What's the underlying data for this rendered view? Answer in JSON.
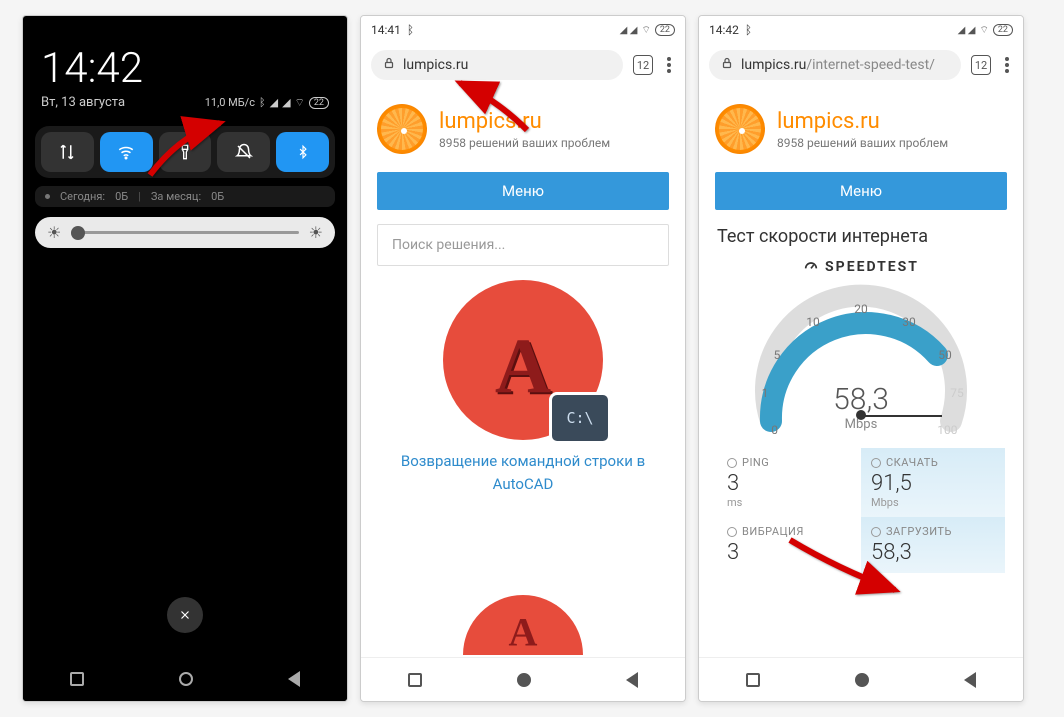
{
  "phone1": {
    "time": "14:42",
    "date": "Вт, 13 августа",
    "net_speed": "11,0 МБ/с",
    "battery": "22",
    "usage_today_label": "Сегодня:",
    "usage_today_val": "0Б",
    "usage_month_label": "За месяц:",
    "usage_month_val": "0Б"
  },
  "phone2": {
    "status_time": "14:41",
    "battery": "22",
    "url": "lumpics.ru",
    "tab_count": "12",
    "site_name": "lumpics.ru",
    "site_tag": "8958 решений ваших проблем",
    "menu": "Меню",
    "search_placeholder": "Поиск решения...",
    "article_title": "Возвращение командной строки в AutoCAD",
    "cmd_prompt": "C:\\"
  },
  "phone3": {
    "status_time": "14:42",
    "battery": "22",
    "url_main": "lumpics.ru",
    "url_path": "/internet-speed-test/",
    "tab_count": "12",
    "site_name": "lumpics.ru",
    "site_tag": "8958 решений ваших проблем",
    "menu": "Меню",
    "page_title": "Тест скорости интернета",
    "speedtest_brand": "SPEEDTEST",
    "gauge": {
      "value": "58,3",
      "unit": "Mbps",
      "ticks": {
        "t0": "0",
        "t1": "1",
        "t5": "5",
        "t10": "10",
        "t20": "20",
        "t30": "30",
        "t50": "50",
        "t75": "75",
        "t100": "100"
      }
    },
    "stats": {
      "ping_label": "PING",
      "ping_val": "3",
      "ping_unit": "ms",
      "download_label": "СКАЧАТЬ",
      "download_val": "91,5",
      "download_unit": "Mbps",
      "jitter_label": "ВИБРАЦИЯ",
      "jitter_val": "3",
      "upload_label": "ЗАГРУЗИТЬ",
      "upload_val": "58,3"
    }
  },
  "chart_data": {
    "type": "gauge",
    "title": "SPEEDTEST",
    "unit": "Mbps",
    "value": 58.3,
    "ticks": [
      0,
      1,
      5,
      10,
      20,
      30,
      50,
      75,
      100
    ],
    "range": [
      0,
      100
    ],
    "metrics": [
      {
        "name": "PING",
        "value": 3,
        "unit": "ms"
      },
      {
        "name": "СКАЧАТЬ",
        "value": 91.5,
        "unit": "Mbps"
      },
      {
        "name": "ВИБРАЦИЯ",
        "value": 3,
        "unit": ""
      },
      {
        "name": "ЗАГРУЗИТЬ",
        "value": 58.3,
        "unit": ""
      }
    ]
  }
}
